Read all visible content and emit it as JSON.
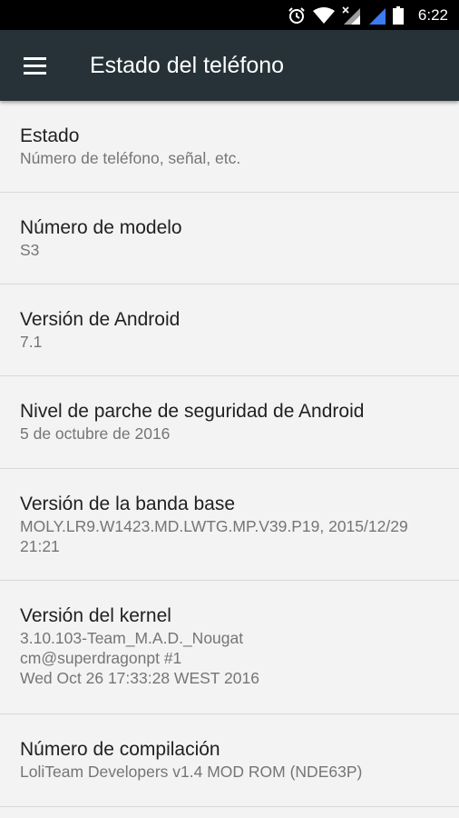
{
  "status_bar": {
    "time": "6:22",
    "icons": [
      "alarm-icon",
      "wifi-icon",
      "no-signal-sim1-icon",
      "signal-icon",
      "battery-icon"
    ]
  },
  "app_bar": {
    "menu_icon": "hamburger-menu-icon",
    "title": "Estado del teléfono",
    "background": "#263238"
  },
  "items": [
    {
      "title": "Estado",
      "subtitle": "Número de teléfono, señal, etc."
    },
    {
      "title": "Número de modelo",
      "subtitle": "S3"
    },
    {
      "title": "Versión de Android",
      "subtitle": "7.1"
    },
    {
      "title": "Nivel de parche de seguridad de Android",
      "subtitle": "5 de octubre de 2016"
    },
    {
      "title": "Versión de la banda base",
      "subtitle": "MOLY.LR9.W1423.MD.LWTG.MP.V39.P19, 2015/12/29\n21:21"
    },
    {
      "title": "Versión del kernel",
      "subtitle": "3.10.103-Team_M.A.D._Nougat\ncm@superdragonpt #1\nWed Oct 26 17:33:28 WEST 2016"
    },
    {
      "title": "Número de compilación",
      "subtitle": "LoliTeam Developers v1.4 MOD ROM (NDE63P)"
    }
  ]
}
